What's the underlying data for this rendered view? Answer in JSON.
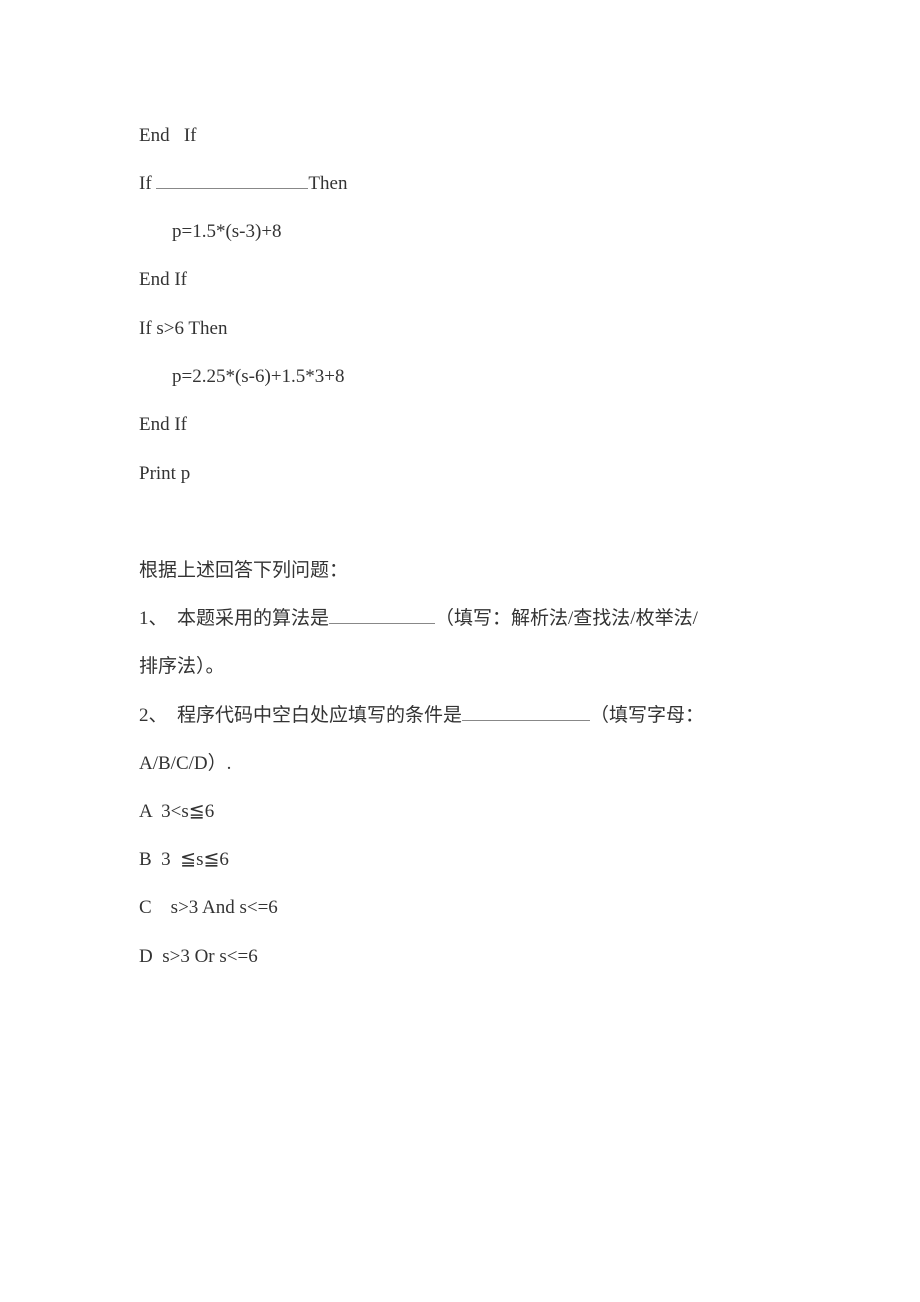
{
  "code": {
    "lines": [
      "End   If",
      "If ",
      "Then",
      "p=1.5*(s-3)+8",
      "End If",
      "If s>6 Then",
      "p=2.25*(s-6)+1.5*3+8",
      "End If",
      "Print p"
    ]
  },
  "questions": {
    "intro": "根据上述回答下列问题：",
    "q1_prefix": "1、  本题采用的算法是",
    "q1_suffix": "（填写：解析法/查找法/枚举法/",
    "q1_cont": "排序法）。",
    "q2_prefix": "2、  程序代码中空白处应填写的条件是",
    "q2_suffix": "（填写字母：",
    "q2_cont": "A/B/C/D）.",
    "options": [
      "A  3<s≦6",
      "B  3  ≦s≦6",
      "C    s>3 And s<=6",
      "D  s>3 Or s<=6"
    ]
  }
}
